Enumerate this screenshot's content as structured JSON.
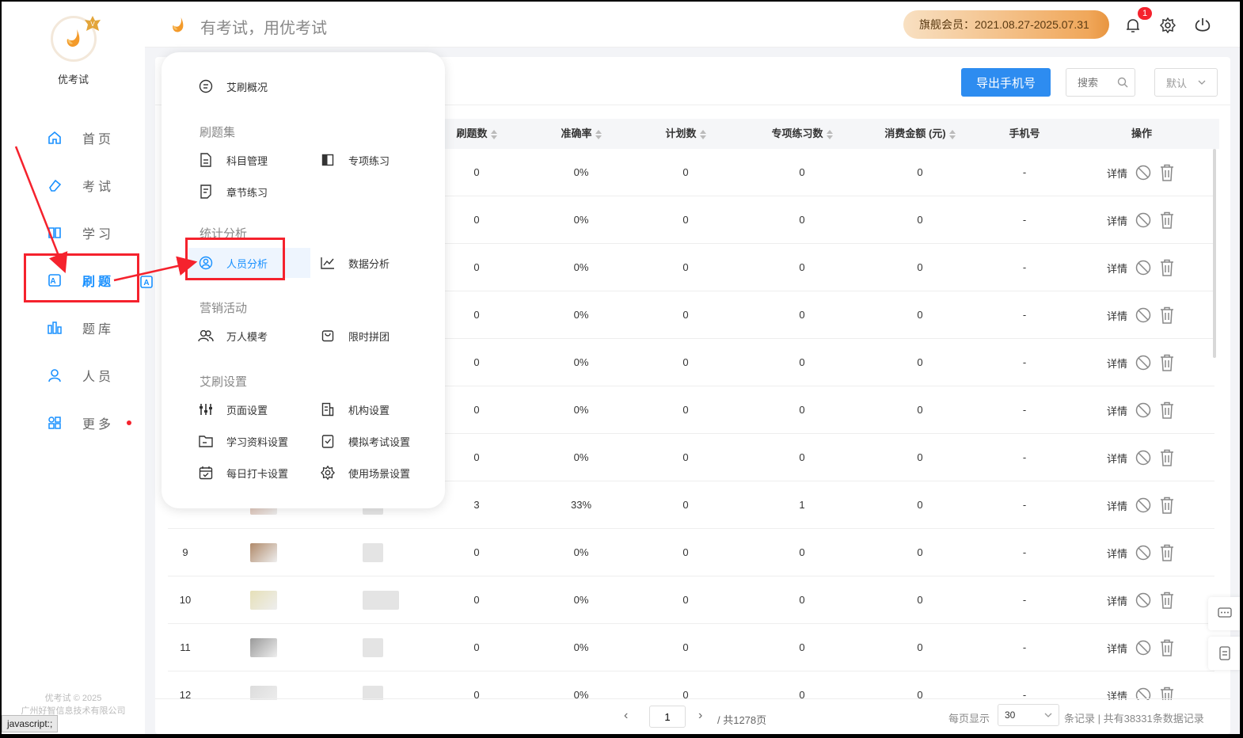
{
  "app": {
    "name": "优考试",
    "slogan": "有考试，用优考试",
    "membership": "旗舰会员：2021.08.27-2025.07.31",
    "notification_count": "1",
    "copyright": "优考试 © 2025",
    "company": "广州好智信息技术有限公司",
    "status_bar": "javascript:;",
    "colors": {
      "primary": "#1890ff",
      "annotation": "#f5222d",
      "member_gradient_end": "#e89540"
    }
  },
  "sidebar": {
    "items": [
      {
        "label": "首页",
        "icon": "home-icon"
      },
      {
        "label": "考试",
        "icon": "eraser-icon"
      },
      {
        "label": "学习",
        "icon": "book-icon"
      },
      {
        "label": "刷题",
        "icon": "a-box-icon",
        "active": true
      },
      {
        "label": "题库",
        "icon": "chart-bars-icon"
      },
      {
        "label": "人员",
        "icon": "user-icon"
      },
      {
        "label": "更多",
        "icon": "apps-icon",
        "dot": true
      }
    ]
  },
  "menu": {
    "overview": "艾刷概况",
    "groups": [
      {
        "title": "刷题集",
        "items": [
          "科目管理",
          "专项练习",
          "章节练习"
        ]
      },
      {
        "title": "统计分析",
        "items": [
          "人员分析",
          "数据分析"
        ]
      },
      {
        "title": "营销活动",
        "items": [
          "万人模考",
          "限时拼团"
        ]
      },
      {
        "title": "艾刷设置",
        "items": [
          "页面设置",
          "机构设置",
          "学习资料设置",
          "模拟考试设置",
          "每日打卡设置",
          "使用场景设置"
        ]
      }
    ]
  },
  "toolbar": {
    "export_label": "导出手机号",
    "search_placeholder": "搜索",
    "sort_select": "默认"
  },
  "table": {
    "columns": [
      "刷题数",
      "准确率",
      "计划数",
      "专项练习数",
      "消费金额 (元)",
      "手机号",
      "操作"
    ],
    "detail_label": "详情",
    "rows": [
      {
        "no": "",
        "count": "0",
        "accuracy": "0%",
        "plan": "0",
        "special": "0",
        "amount": "0",
        "phone": "-"
      },
      {
        "no": "",
        "count": "0",
        "accuracy": "0%",
        "plan": "0",
        "special": "0",
        "amount": "0",
        "phone": "-"
      },
      {
        "no": "",
        "count": "0",
        "accuracy": "0%",
        "plan": "0",
        "special": "0",
        "amount": "0",
        "phone": "-"
      },
      {
        "no": "",
        "count": "0",
        "accuracy": "0%",
        "plan": "0",
        "special": "0",
        "amount": "0",
        "phone": "-"
      },
      {
        "no": "",
        "count": "0",
        "accuracy": "0%",
        "plan": "0",
        "special": "0",
        "amount": "0",
        "phone": "-"
      },
      {
        "no": "",
        "count": "0",
        "accuracy": "0%",
        "plan": "0",
        "special": "0",
        "amount": "0",
        "phone": "-"
      },
      {
        "no": "",
        "count": "0",
        "accuracy": "0%",
        "plan": "0",
        "special": "0",
        "amount": "0",
        "phone": "-"
      },
      {
        "no": "",
        "count": "3",
        "accuracy": "33%",
        "plan": "0",
        "special": "1",
        "amount": "0",
        "phone": "-"
      },
      {
        "no": "9",
        "count": "0",
        "accuracy": "0%",
        "plan": "0",
        "special": "0",
        "amount": "0",
        "phone": "-"
      },
      {
        "no": "10",
        "count": "0",
        "accuracy": "0%",
        "plan": "0",
        "special": "0",
        "amount": "0",
        "phone": "-"
      },
      {
        "no": "11",
        "count": "0",
        "accuracy": "0%",
        "plan": "0",
        "special": "0",
        "amount": "0",
        "phone": "-"
      },
      {
        "no": "12",
        "count": "0",
        "accuracy": "0%",
        "plan": "0",
        "special": "0",
        "amount": "0",
        "phone": "-"
      }
    ]
  },
  "pagination": {
    "current_page": "1",
    "total_pages": "/ 共1278页",
    "per_page_label": "每页显示",
    "per_page": "30",
    "records": "条记录 | 共有38331条数据记录"
  }
}
